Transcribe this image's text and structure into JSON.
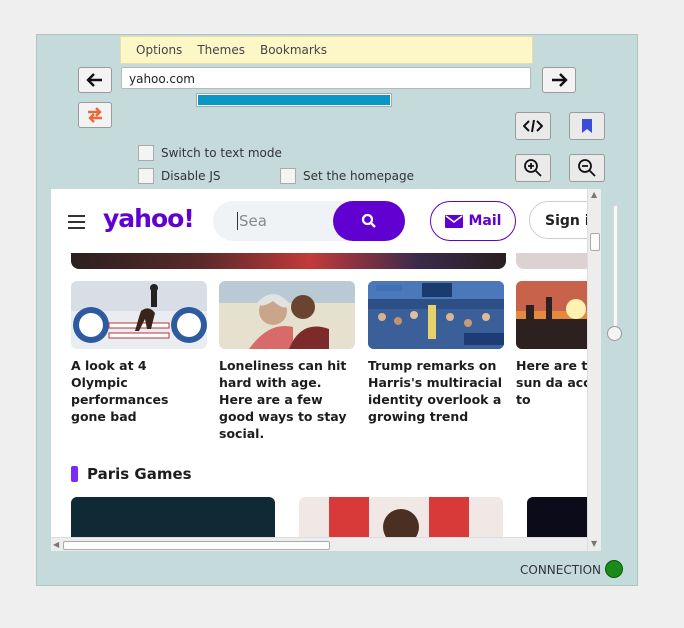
{
  "menu": {
    "options": "Options",
    "themes": "Themes",
    "bookmarks": "Bookmarks"
  },
  "browser": {
    "url": "yahoo.com",
    "progress_percent": 100,
    "switch_text_mode": "Switch to text mode",
    "disable_js": "Disable JS",
    "set_homepage": "Set the homepage",
    "connection_label": "CONNECTION",
    "connection_color": "#1a8a1a"
  },
  "page": {
    "logo": "yahoo!",
    "search_placeholder": "Sea",
    "mail_label": "Mail",
    "signin_label": "Sign in",
    "cards": [
      {
        "caption": "A look at 4 Olympic performances gone bad"
      },
      {
        "caption": "Loneliness can hit hard with age. Here are a few good ways to stay social."
      },
      {
        "caption": "Trump remarks on Harris's multiracial identity overlook a growing trend"
      },
      {
        "caption": "Here are the have sun da according to"
      }
    ],
    "section_title": "Paris Games"
  },
  "colors": {
    "accent": "#6001d2",
    "progress": "#0a97c6",
    "panel": "#c5dadb"
  }
}
